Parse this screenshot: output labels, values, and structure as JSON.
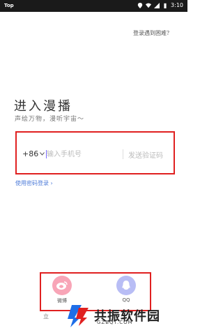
{
  "status_bar": {
    "carrier": "Top",
    "time": "3:10"
  },
  "help_link": "登录遇到困难？",
  "title": "进入漫播",
  "subtitle": "声绘万物，漫听宇宙～",
  "phone": {
    "country_code": "+86",
    "placeholder": "输入手机号",
    "send_code": "发送验证码"
  },
  "password_login": "使用密码登录",
  "social": [
    {
      "label": "微博"
    },
    {
      "label": "QQ"
    }
  ],
  "footer_fragment": "立",
  "brand": {
    "name": "共振软件园",
    "url": "GZBQT.COM"
  },
  "colors": {
    "highlight_border": "#e02020",
    "link": "#4d7bd9",
    "weibo": "#f8a5b7",
    "qq": "#b8bdf5"
  }
}
